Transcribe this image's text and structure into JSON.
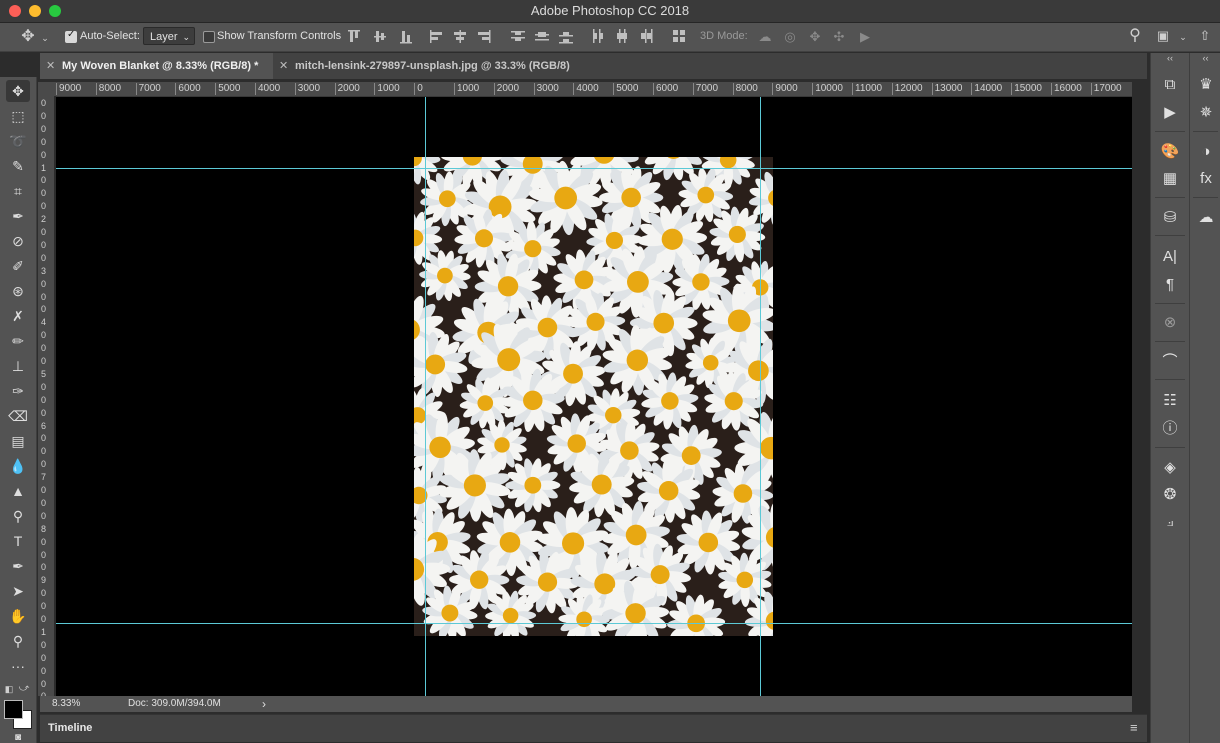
{
  "window": {
    "title": "Adobe Photoshop CC 2018",
    "traffic_lights": [
      "#fc5f57",
      "#fdbc2e",
      "#28c940"
    ]
  },
  "options_bar": {
    "move_tool_icon": "move-icon",
    "auto_select_label": "Auto-Select:",
    "auto_select_checked": true,
    "auto_select_value": "Layer",
    "show_transform_label": "Show Transform Controls",
    "show_transform_checked": false,
    "mode_3d_label": "3D Mode:"
  },
  "tabs": [
    {
      "label": "My Woven Blanket @ 8.33% (RGB/8) *",
      "active": true
    },
    {
      "label": "mitch-lensink-279897-unsplash.jpg @ 33.3% (RGB/8)",
      "active": false
    }
  ],
  "ruler": {
    "h_ticks": [
      "9000",
      "8000",
      "7000",
      "6000",
      "5000",
      "4000",
      "3000",
      "2000",
      "1000",
      "0",
      "1000",
      "2000",
      "3000",
      "4000",
      "5000",
      "6000",
      "7000",
      "8000",
      "9000",
      "10000",
      "11000",
      "12000",
      "13000",
      "14000",
      "15000",
      "16000",
      "17000"
    ],
    "v_ticks": [
      "0",
      "0",
      "0",
      "0",
      "0",
      "1",
      "0",
      "0",
      "0",
      "2",
      "0",
      "0",
      "0",
      "3",
      "0",
      "0",
      "0",
      "4",
      "0",
      "0",
      "0",
      "5",
      "0",
      "0",
      "0",
      "6",
      "0",
      "0",
      "0",
      "7",
      "0",
      "0",
      "0",
      "8",
      "0",
      "0",
      "0",
      "9",
      "0",
      "0",
      "0",
      "1",
      "0",
      "0",
      "0",
      "0",
      "0"
    ]
  },
  "status_bar": {
    "zoom": "8.33%",
    "doc_info": "Doc: 309.0M/394.0M",
    "arrow": "›"
  },
  "timeline": {
    "label": "Timeline"
  },
  "colors": {
    "foreground": "#000000",
    "background": "#ffffff",
    "guide": "#5cc9d6",
    "flower_yellow": "#e8a812",
    "flower_dark_bg": "#2a1f1a"
  }
}
